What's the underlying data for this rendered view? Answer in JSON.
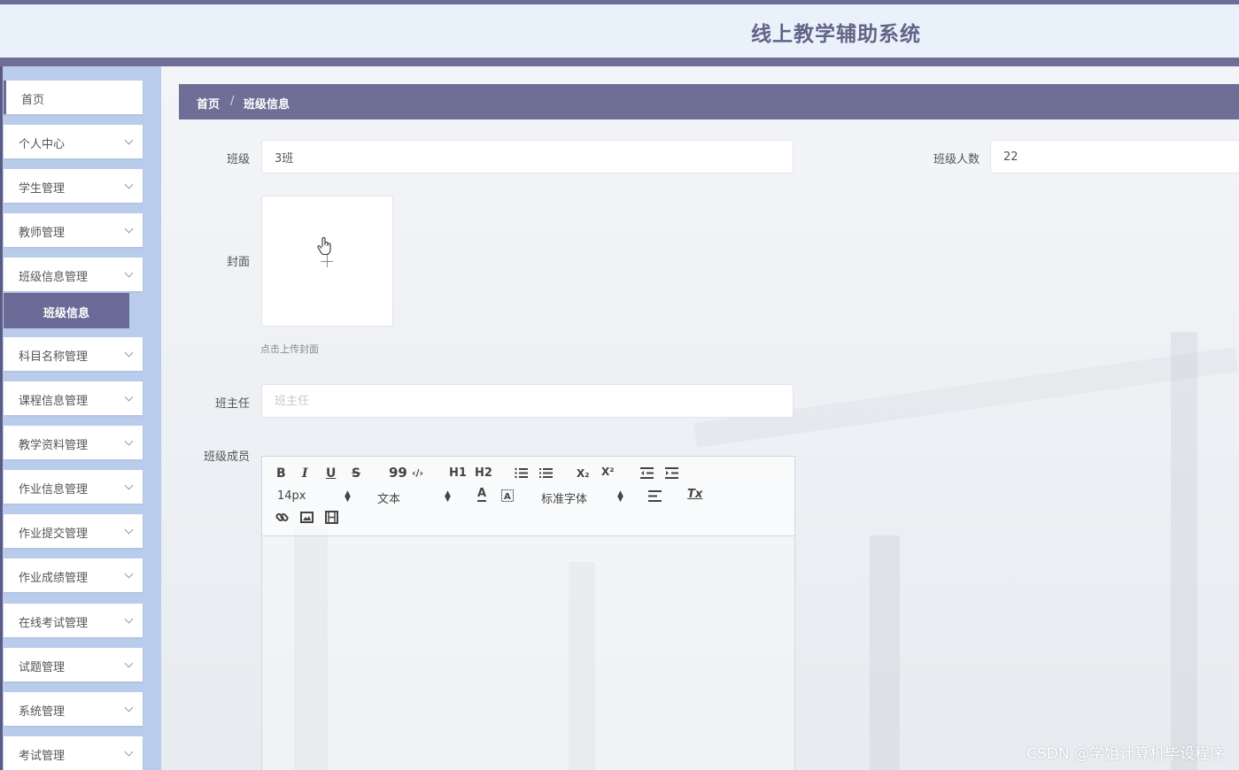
{
  "header": {
    "title": "线上教学辅助系统"
  },
  "sidebar": {
    "items": [
      {
        "label": "首页"
      },
      {
        "label": "个人中心"
      },
      {
        "label": "学生管理"
      },
      {
        "label": "教师管理"
      },
      {
        "label": "班级信息管理"
      },
      {
        "label": "科目名称管理"
      },
      {
        "label": "课程信息管理"
      },
      {
        "label": "教学资料管理"
      },
      {
        "label": "作业信息管理"
      },
      {
        "label": "作业提交管理"
      },
      {
        "label": "作业成绩管理"
      },
      {
        "label": "在线考试管理"
      },
      {
        "label": "试题管理"
      },
      {
        "label": "系统管理"
      },
      {
        "label": "考试管理"
      }
    ],
    "active_sub": "班级信息"
  },
  "breadcrumb": {
    "home": "首页",
    "separator": "/",
    "current": "班级信息"
  },
  "form": {
    "class_label": "班级",
    "class_value": "3班",
    "count_label": "班级人数",
    "count_value": "22",
    "cover_label": "封面",
    "cover_hint": "点击上传封面",
    "teacher_label": "班主任",
    "teacher_placeholder": "班主任",
    "members_label": "班级成员"
  },
  "editor": {
    "font_size": "14px",
    "block_format": "文本",
    "font_family": "标准字体",
    "icons": [
      "bold-icon",
      "italic-icon",
      "underline-icon",
      "strike-icon",
      "quote-icon",
      "code-icon",
      "h1-icon",
      "h2-icon",
      "ordered-list-icon",
      "bullet-list-icon",
      "subscript-icon",
      "superscript-icon",
      "outdent-icon",
      "indent-icon",
      "font-color-icon",
      "background-color-icon",
      "align-icon",
      "clear-format-icon",
      "link-icon",
      "image-icon",
      "video-icon"
    ],
    "toolbar_text": {
      "bold": "B",
      "italic": "I",
      "underline": "U",
      "strike": "S",
      "quote": "99",
      "code": "‹/›",
      "h1": "H1",
      "h2": "H2",
      "sub": "X₂",
      "sup": "X²",
      "color": "A",
      "clear": "Tx"
    }
  },
  "watermark": "CSDN @学姐计算机毕设程序",
  "colors": {
    "accent": "#6f6e97",
    "sidebar_bg": "#b9ccec",
    "header_bg": "#e9f1fb"
  }
}
